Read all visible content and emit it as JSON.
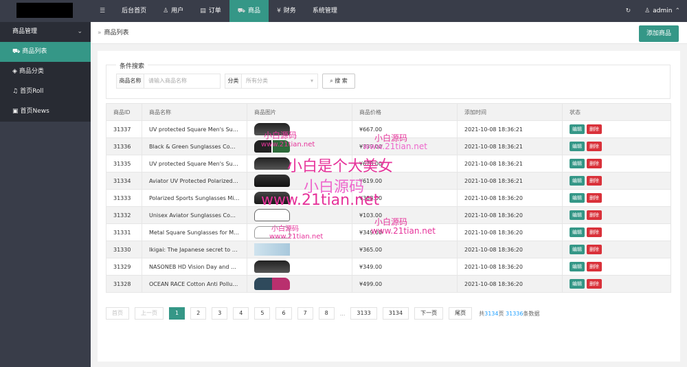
{
  "topbar": {
    "nav": [
      {
        "label": "后台首页",
        "icon": ""
      },
      {
        "label": "用户",
        "icon": "user-icon"
      },
      {
        "label": "订单",
        "icon": "document-icon"
      },
      {
        "label": "商品",
        "icon": "cart-icon"
      },
      {
        "label": "财务",
        "icon": "yen-icon"
      },
      {
        "label": "系统管理",
        "icon": ""
      }
    ],
    "active_index": 3,
    "user": "admin"
  },
  "sidebar": {
    "group": "商品管理",
    "items": [
      {
        "label": "商品列表",
        "icon": "cart-icon"
      },
      {
        "label": "商品分类",
        "icon": "layers-icon"
      },
      {
        "label": "首页Roll",
        "icon": "bell-icon"
      },
      {
        "label": "首页News",
        "icon": "news-icon"
      }
    ],
    "active_index": 0
  },
  "breadcrumb": {
    "sep": "»",
    "label": "商品列表"
  },
  "add_button": "添加商品",
  "search": {
    "legend": "条件搜索",
    "name_label": "商品名称",
    "name_placeholder": "请输入商品名称",
    "category_label": "分类",
    "category_value": "所有分类",
    "button": "搜 索"
  },
  "table": {
    "columns": [
      "商品ID",
      "商品名称",
      "商品图片",
      "商品价格",
      "添加时间",
      "状态"
    ],
    "edit_label": "编辑",
    "delete_label": "删除",
    "rows": [
      {
        "id": "31337",
        "name": "UV protected Square Men's Sungla...",
        "price": "¥667.00",
        "time": "2021-10-08 18:36:21",
        "img": "sunglasses-black"
      },
      {
        "id": "31336",
        "name": "Black & Green Sunglasses Combo ...",
        "price": "¥339.00",
        "time": "2021-10-08 18:36:21",
        "img": "sunglasses-combo"
      },
      {
        "id": "31335",
        "name": "UV protected Square Men's Sungla...",
        "price": "¥678.00",
        "time": "2021-10-08 18:36:21",
        "img": "sunglasses-black"
      },
      {
        "id": "31334",
        "name": "Aviator UV Protected Polarized Blac...",
        "price": "¥619.00",
        "time": "2021-10-08 18:36:21",
        "img": "sunglasses-aviator"
      },
      {
        "id": "31333",
        "name": "Polarized Sports Sunglasses Mirror ...",
        "price": "¥388.00",
        "time": "2021-10-08 18:36:20",
        "img": "sunglasses-sport"
      },
      {
        "id": "31332",
        "name": "Unisex Aviator Sunglasses Combo (...",
        "price": "¥103.00",
        "time": "2021-10-08 18:36:20",
        "img": "sunglasses-aviator-combo"
      },
      {
        "id": "31331",
        "name": "Metal Square Sunglasses for Men a...",
        "price": "¥349.00",
        "time": "2021-10-08 18:36:20",
        "img": "sunglasses-metal"
      },
      {
        "id": "31330",
        "name": "Ikigai: The Japanese secret to a lon...",
        "price": "¥365.00",
        "time": "2021-10-08 18:36:20",
        "img": "book"
      },
      {
        "id": "31329",
        "name": "NASONEB HD Vision Day and Night...",
        "price": "¥349.00",
        "time": "2021-10-08 18:36:20",
        "img": "sunglasses-black"
      },
      {
        "id": "31328",
        "name": "OCEAN RACE Cotton Anti Pollution...",
        "price": "¥499.00",
        "time": "2021-10-08 18:36:20",
        "img": "mask"
      }
    ]
  },
  "pager": {
    "first": "首页",
    "prev": "上一页",
    "pages": [
      "1",
      "2",
      "3",
      "4",
      "5",
      "6",
      "7",
      "8"
    ],
    "ellipsis": "...",
    "tail_pages": [
      "3133",
      "3134"
    ],
    "next": "下一页",
    "last": "尾页",
    "info_prefix": "共",
    "total_pages": "3134",
    "info_mid": "页",
    "total_items": "31336",
    "info_suffix": "条数据",
    "current": "1"
  },
  "watermarks": [
    {
      "text": "小白源码",
      "color": "#e6339a"
    },
    {
      "text": "www.21tian.net",
      "color": "#e6339a"
    },
    {
      "text": "小白源码",
      "color": "#e6339a"
    },
    {
      "text": "www.21tian.net",
      "color": "#ee66cc"
    },
    {
      "text": "小白是个大美女",
      "color": "#e6339a"
    },
    {
      "text": "小白源码",
      "color": "#ee66cc"
    },
    {
      "text": "www.21tian.net",
      "color": "#e6339a"
    },
    {
      "text": "小白源码",
      "color": "#e6339a"
    },
    {
      "text": "www.21tian.net",
      "color": "#e6339a"
    },
    {
      "text": "小白源码",
      "color": "#e6339a"
    },
    {
      "text": "www.21tian.net",
      "color": "#e6339a"
    }
  ]
}
